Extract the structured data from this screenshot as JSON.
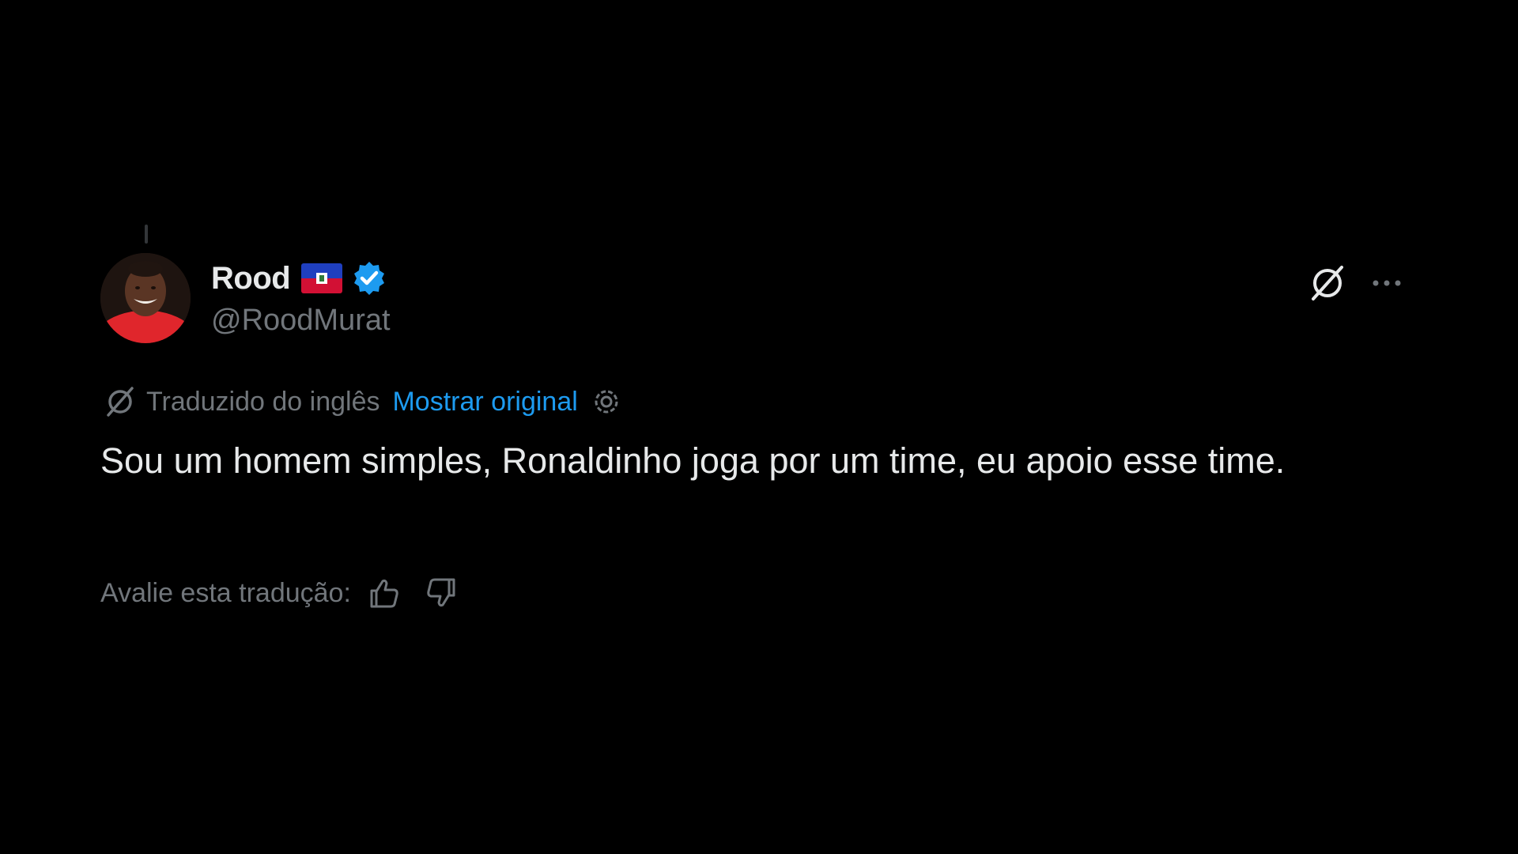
{
  "author": {
    "display_name": "Rood",
    "handle": "@RoodMurat",
    "flag_icon": "haiti-flag-icon",
    "verified_icon": "verified-badge-icon"
  },
  "actions": {
    "grok_icon": "grok-icon",
    "more_icon": "more-icon"
  },
  "translation": {
    "label": "Traduzido do inglês",
    "show_original": "Mostrar original",
    "settings_icon": "gear-icon"
  },
  "tweet": {
    "text": "Sou um homem simples, Ronaldinho joga por um time, eu apoio esse time."
  },
  "rating": {
    "label": "Avalie esta tradução:",
    "thumbs_up_icon": "thumbs-up-icon",
    "thumbs_down_icon": "thumbs-down-icon"
  },
  "colors": {
    "background": "#000000",
    "text": "#e7e9ea",
    "secondary_text": "#71767b",
    "link": "#1d9bf0",
    "verified": "#1d9bf0"
  }
}
